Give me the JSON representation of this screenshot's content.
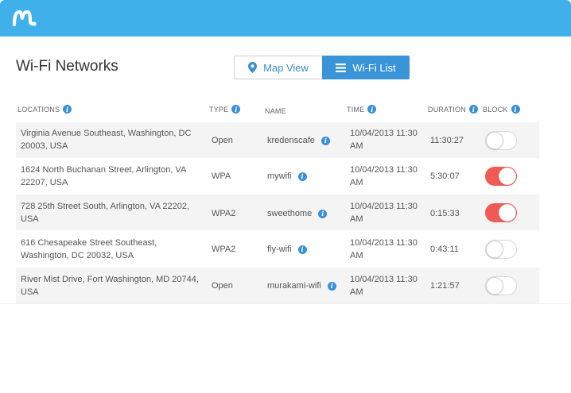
{
  "app": {
    "brand_color": "#3fb0ea",
    "logo_icon": "mspy-m-logo"
  },
  "page": {
    "title": "Wi-Fi Networks"
  },
  "view_toggle": {
    "map_label": "Map View",
    "map_icon": "map-pin-icon",
    "list_label": "Wi-Fi List",
    "list_icon": "list-icon",
    "active": "list"
  },
  "table": {
    "columns": {
      "locations": "LOCATIONS",
      "type": "TYPE",
      "name": "NAME",
      "time": "TIME",
      "duration": "DURATION",
      "block": "BLOCK"
    },
    "rows": [
      {
        "location_line1": "Virginia Avenue Southeast, Washington, DC",
        "location_line2": "20003, USA",
        "type": "Open",
        "name": "kredenscafe",
        "time_line1": "10/04/2013 11:30",
        "time_line2": "AM",
        "duration": "11:30:27",
        "blocked": false
      },
      {
        "location_line1": "1624 North Buchanan Street, Arlington, VA",
        "location_line2": "22207, USA",
        "type": "WPA",
        "name": "mywifi",
        "time_line1": "10/04/2013 11:30",
        "time_line2": "AM",
        "duration": "5:30:07",
        "blocked": true
      },
      {
        "location_line1": "728 25th Street South, Arlington, VA 22202,",
        "location_line2": "USA",
        "type": "WPA2",
        "name": "sweethome",
        "time_line1": "10/04/2013 11:30",
        "time_line2": "AM",
        "duration": "0:15:33",
        "blocked": true
      },
      {
        "location_line1": "616 Chesapeake Street Southeast,",
        "location_line2": "Washington, DC 20032, USA",
        "type": "WPA2",
        "name": "fly-wifi",
        "time_line1": "10/04/2013 11:30",
        "time_line2": "AM",
        "duration": "0:43:11",
        "blocked": false
      },
      {
        "location_line1": "River Mist Drive, Fort Washington, MD 20744,",
        "location_line2": "USA",
        "type": "Open",
        "name": "murakami-wifi",
        "time_line1": "10/04/2013 11:30",
        "time_line2": "AM",
        "duration": "1:21:57",
        "blocked": false
      }
    ]
  },
  "colors": {
    "toggle_on": "#f15a54",
    "accent_blue": "#3a95d8",
    "row_alt": "#f4f4f4"
  }
}
